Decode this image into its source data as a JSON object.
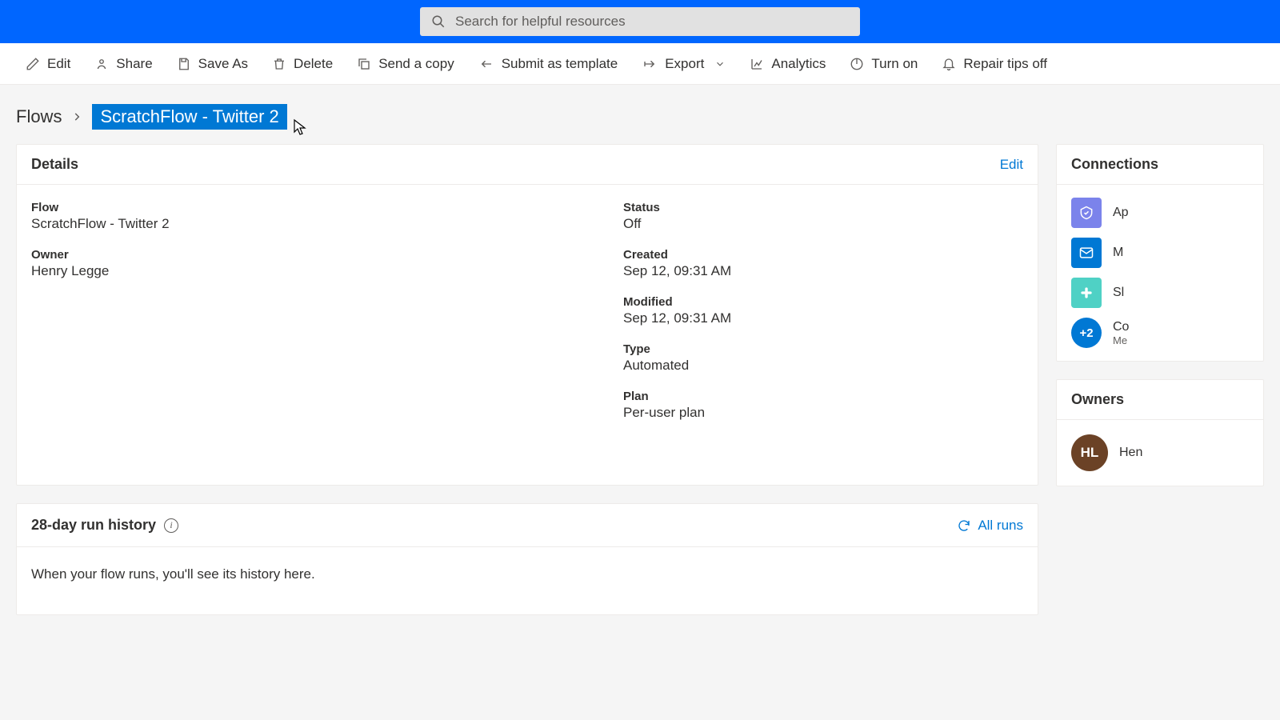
{
  "search": {
    "placeholder": "Search for helpful resources"
  },
  "commands": {
    "edit": "Edit",
    "share": "Share",
    "save_as": "Save As",
    "delete": "Delete",
    "send_copy": "Send a copy",
    "submit_template": "Submit as template",
    "export": "Export",
    "analytics": "Analytics",
    "turn_on": "Turn on",
    "repair_tips": "Repair tips off"
  },
  "breadcrumb": {
    "root": "Flows",
    "current": "ScratchFlow - Twitter 2"
  },
  "details": {
    "title": "Details",
    "edit_link": "Edit",
    "flow_label": "Flow",
    "flow_value": "ScratchFlow - Twitter 2",
    "owner_label": "Owner",
    "owner_value": "Henry Legge",
    "status_label": "Status",
    "status_value": "Off",
    "created_label": "Created",
    "created_value": "Sep 12, 09:31 AM",
    "modified_label": "Modified",
    "modified_value": "Sep 12, 09:31 AM",
    "type_label": "Type",
    "type_value": "Automated",
    "plan_label": "Plan",
    "plan_value": "Per-user plan"
  },
  "connections": {
    "title": "Connections",
    "items": [
      {
        "label": "Ap",
        "color": "#7b83eb"
      },
      {
        "label": "M",
        "color": "#0078d4"
      },
      {
        "label": "Sl",
        "color": "#4fd1c5"
      }
    ],
    "more_count": "+2",
    "more_label_a": "Co",
    "more_label_b": "Me"
  },
  "owners": {
    "title": "Owners",
    "initials": "HL",
    "name": "Hen"
  },
  "history": {
    "title": "28-day run history",
    "all_runs": "All runs",
    "empty": "When your flow runs, you'll see its history here."
  }
}
